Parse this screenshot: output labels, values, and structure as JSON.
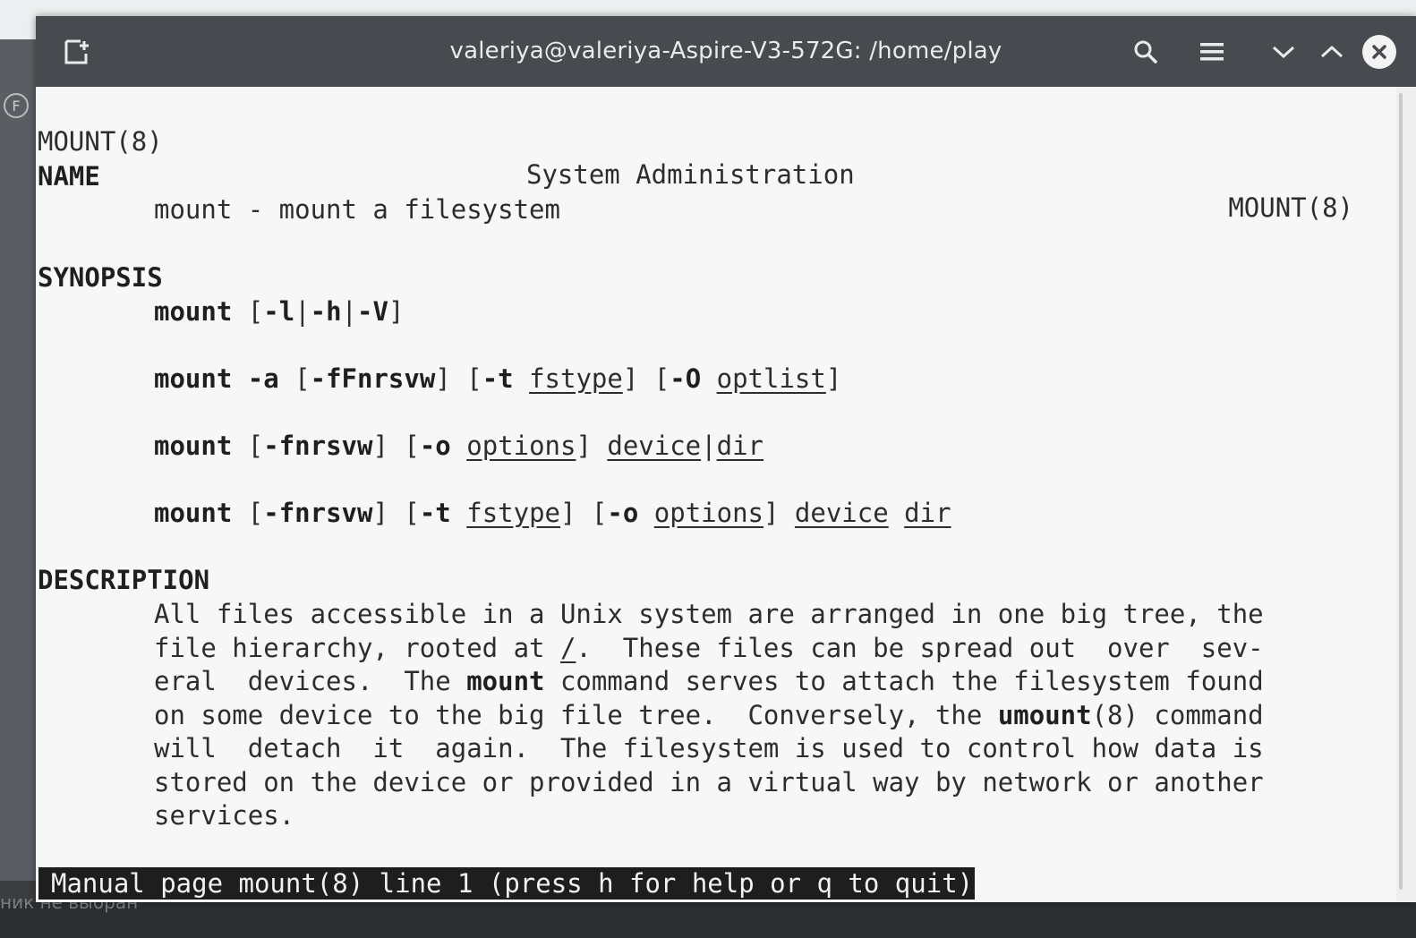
{
  "desktop": {
    "left_icon": "F",
    "bottom_text": "ник не выбран"
  },
  "window": {
    "title": "valeriya@valeriya-Aspire-V3-572G: /home/play",
    "icons": {
      "new_tab": "new-tab-icon",
      "search": "search-icon",
      "menu": "hamburger-menu-icon",
      "minimize": "chevron-down-icon",
      "maximize": "chevron-up-icon",
      "close": "close-icon"
    }
  },
  "man": {
    "header_left": "MOUNT(8)",
    "header_center": "System Administration",
    "header_right": "MOUNT(8)",
    "name_heading": "NAME",
    "name_text": "mount - mount a filesystem",
    "synopsis_heading": "SYNOPSIS",
    "description_heading": "DESCRIPTION",
    "desc_lines": [
      "All files accessible in a Unix system are arranged in one big tree, the",
      "file hierarchy, rooted at /.  These files can be spread out  over  sev-",
      "eral  devices.  The mount command serves to attach the filesystem found",
      "on some device to the big file tree.  Conversely, the umount(8) command",
      "will  detach  it  again.  The filesystem is used to control how data is",
      "stored on the device or provided in a virtual way by network or another",
      "services."
    ]
  },
  "status_line": "Manual page mount(8) line 1 (press h for help or q to quit)"
}
